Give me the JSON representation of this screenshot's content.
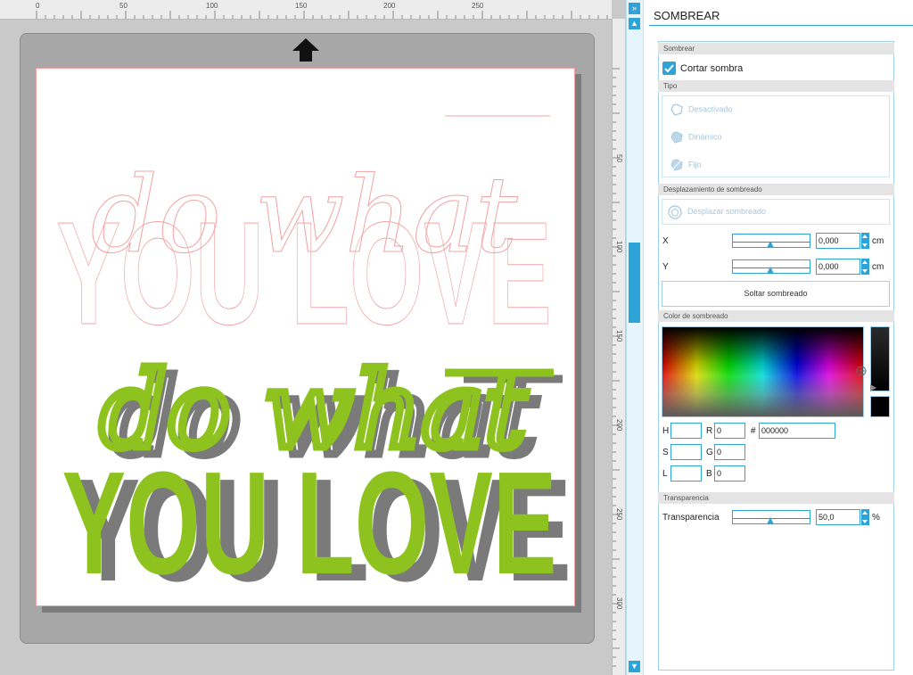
{
  "ruler": {
    "h_labels": [
      "0",
      "50",
      "100",
      "150",
      "200",
      "250"
    ],
    "v_labels": [
      "50",
      "100",
      "150",
      "200",
      "250",
      "300"
    ]
  },
  "canvas": {
    "text_outline_top": "do what",
    "text_outline_bottom": "YOU LOVE",
    "text_shadow_top": "do what",
    "text_shadow_bottom": "YOU LOVE",
    "colors": {
      "outline": "#f2a3a3",
      "fill": "#8dc21f",
      "shadow": "#7a7a7a"
    }
  },
  "scroll": {
    "collapse_icon": "double-chevron-right-icon",
    "up_icon": "triangle-up-icon",
    "down_icon": "triangle-down-icon"
  },
  "panel": {
    "title": "SOMBREAR",
    "section_shadow": "Sombrear",
    "cut_shadow_label": "Cortar sombra",
    "cut_shadow_checked": true,
    "section_type": "Tipo",
    "type_options": [
      "Desactivado",
      "Dinámico",
      "Fijo"
    ],
    "section_offset": "Desplazamiento de sombreado",
    "offset_button": "Desplazar sombreado",
    "x_label": "X",
    "x_value": "0,000",
    "y_label": "Y",
    "y_value": "0,000",
    "unit_cm": "cm",
    "release_button": "Soltar sombreado",
    "section_color": "Color de sombreado",
    "color": {
      "h_label": "H",
      "h_value": "",
      "s_label": "S",
      "s_value": "",
      "l_label": "L",
      "l_value": "",
      "r_label": "R",
      "r_value": "0",
      "g_label": "G",
      "g_value": "0",
      "b_label": "B",
      "b_value": "0",
      "hash_label": "#",
      "hex_value": "000000",
      "swatch": "#000000"
    },
    "section_transparency": "Transparencia",
    "transparency_label": "Transparencia",
    "transparency_value": "50,0",
    "unit_percent": "%"
  }
}
